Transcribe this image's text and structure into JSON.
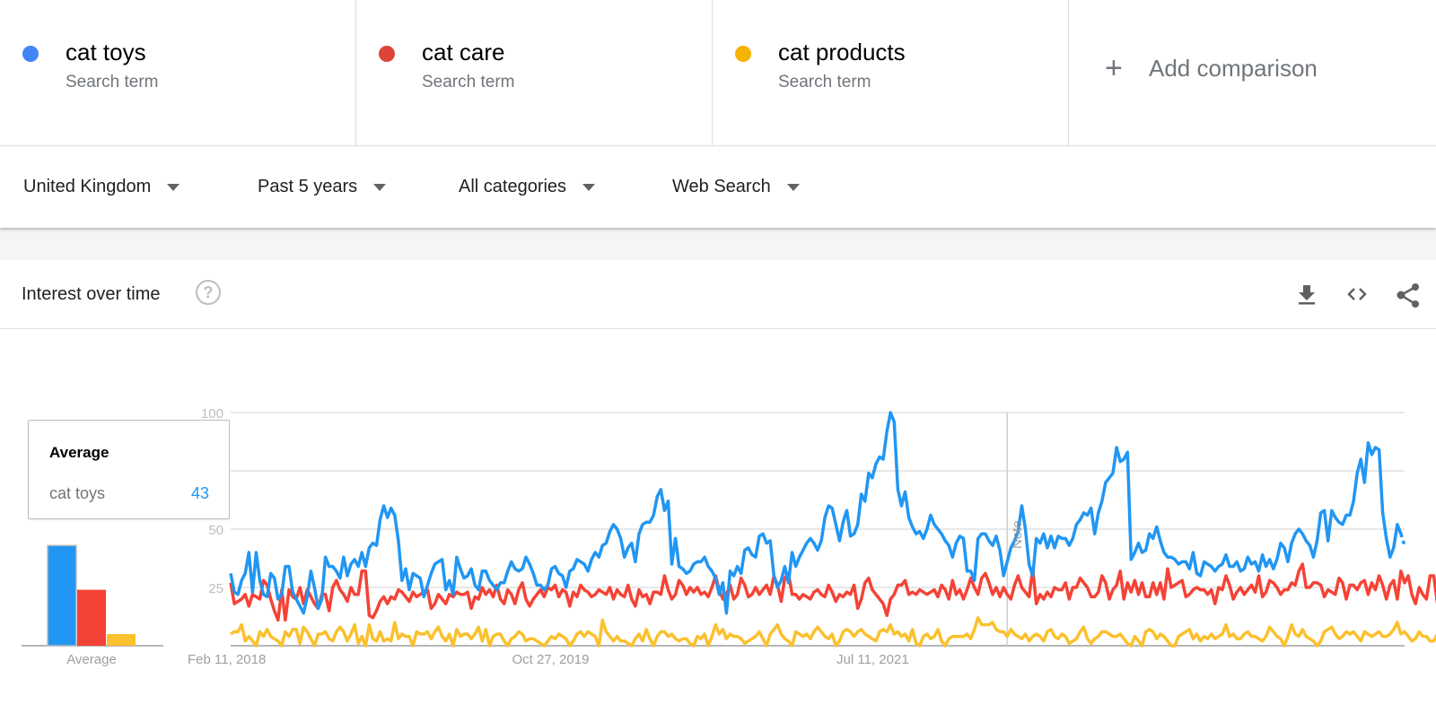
{
  "terms": [
    {
      "name": "cat toys",
      "subtitle": "Search term",
      "color": "#4285f4"
    },
    {
      "name": "cat care",
      "subtitle": "Search term",
      "color": "#db4437"
    },
    {
      "name": "cat products",
      "subtitle": "Search term",
      "color": "#f4b400"
    }
  ],
  "add_comparison": {
    "icon": "plus-icon",
    "label": "Add comparison"
  },
  "filters": [
    {
      "label": "United Kingdom"
    },
    {
      "label": "Past 5 years"
    },
    {
      "label": "All categories"
    },
    {
      "label": "Web Search"
    }
  ],
  "card": {
    "title": "Interest over time",
    "help_icon": "question-circle-icon",
    "actions": [
      "download-icon",
      "embed-code-icon",
      "share-icon"
    ]
  },
  "tooltip": {
    "title": "Average",
    "term": "cat toys",
    "value": "43"
  },
  "chart_data": [
    {
      "type": "bar",
      "title": "Average",
      "xlabel": "Average",
      "categories": [
        "cat toys",
        "cat care",
        "cat products"
      ],
      "values": [
        43,
        24,
        5
      ],
      "colors": [
        "#2196f3",
        "#f44336",
        "#fbc02d"
      ],
      "ylim": [
        0,
        100
      ]
    },
    {
      "type": "line",
      "title": "Interest over time",
      "ylabel": "",
      "xlabel": "",
      "ylim": [
        0,
        100
      ],
      "yticks": [
        25,
        50,
        75,
        100
      ],
      "xtick_labels": [
        {
          "label": "Feb 11, 2018",
          "index": 0
        },
        {
          "label": "Oct 27, 2019",
          "index": 89
        },
        {
          "label": "Jul 11, 2021",
          "index": 178
        }
      ],
      "annotation": {
        "label": "Note",
        "index": 213
      },
      "grid": true,
      "legend": "none",
      "x_start": "Feb 11, 2018",
      "x_step": "week",
      "partial_last_point": true,
      "series": [
        {
          "name": "cat toys",
          "color": "#2196f3",
          "values": [
            31,
            23,
            22,
            28,
            31,
            40,
            23,
            40,
            28,
            22,
            21,
            31,
            29,
            20,
            22,
            34,
            34,
            23,
            20,
            17,
            14,
            21,
            32,
            25,
            16,
            20,
            38,
            34,
            34,
            32,
            29,
            38,
            30,
            35,
            37,
            34,
            40,
            34,
            42,
            44,
            43,
            54,
            60,
            55,
            59,
            56,
            45,
            28,
            33,
            24,
            31,
            30,
            29,
            21,
            26,
            31,
            35,
            36,
            37,
            24,
            28,
            22,
            38,
            33,
            29,
            30,
            33,
            26,
            24,
            32,
            32,
            28,
            26,
            24,
            27,
            27,
            32,
            36,
            33,
            32,
            33,
            38,
            35,
            31,
            26,
            26,
            24,
            26,
            33,
            34,
            31,
            30,
            25,
            32,
            33,
            37,
            36,
            35,
            32,
            37,
            40,
            38,
            43,
            44,
            49,
            52,
            50,
            46,
            38,
            42,
            44,
            36,
            48,
            52,
            53,
            53,
            56,
            64,
            67,
            58,
            62,
            35,
            46,
            34,
            33,
            31,
            32,
            35,
            36,
            36,
            38,
            34,
            32,
            29,
            22,
            27,
            14,
            32,
            30,
            34,
            31,
            41,
            42,
            39,
            38,
            47,
            48,
            44,
            45,
            30,
            25,
            28,
            34,
            27,
            40,
            34,
            38,
            41,
            44,
            46,
            44,
            41,
            45,
            55,
            60,
            59,
            52,
            45,
            53,
            58,
            47,
            48,
            52,
            65,
            62,
            74,
            72,
            78,
            81,
            80,
            92,
            100,
            96,
            67,
            60,
            66,
            55,
            51,
            48,
            49,
            46,
            50,
            56,
            52,
            50,
            48,
            45,
            43,
            38,
            44,
            47,
            46,
            32,
            32,
            28,
            46,
            48,
            48,
            45,
            43,
            47,
            41,
            30,
            36,
            42,
            45,
            49,
            60,
            50,
            35,
            30,
            46,
            44,
            48,
            42,
            47,
            42,
            47,
            46,
            46,
            43,
            46,
            52,
            54,
            57,
            56,
            59,
            48,
            57,
            62,
            70,
            72,
            74,
            85,
            79,
            80,
            83,
            37,
            40,
            44,
            40,
            41,
            48,
            46,
            51,
            45,
            40,
            38,
            38,
            37,
            35,
            36,
            36,
            33,
            40,
            31,
            30,
            36,
            35,
            34,
            32,
            34,
            35,
            39,
            34,
            34,
            36,
            32,
            33,
            38,
            35,
            36,
            32,
            39,
            34,
            37,
            33,
            37,
            44,
            42,
            36,
            44,
            48,
            50,
            48,
            45,
            43,
            38,
            45,
            57,
            58,
            45,
            58,
            55,
            53,
            52,
            56,
            56,
            62,
            74,
            80,
            70,
            87,
            82,
            85,
            84,
            57,
            46,
            38,
            42,
            52,
            48,
            43
          ]
        },
        {
          "name": "cat care",
          "color": "#f44336",
          "values": [
            27,
            18,
            19,
            20,
            22,
            17,
            22,
            21,
            20,
            28,
            26,
            20,
            15,
            11,
            24,
            11,
            24,
            21,
            20,
            25,
            18,
            24,
            21,
            18,
            16,
            22,
            22,
            15,
            25,
            28,
            24,
            22,
            19,
            25,
            22,
            22,
            32,
            32,
            13,
            12,
            15,
            19,
            21,
            18,
            21,
            20,
            24,
            23,
            21,
            19,
            23,
            21,
            22,
            23,
            24,
            16,
            18,
            22,
            20,
            18,
            22,
            21,
            23,
            22,
            22,
            23,
            16,
            21,
            20,
            25,
            22,
            24,
            21,
            26,
            20,
            18,
            24,
            22,
            18,
            24,
            27,
            20,
            17,
            20,
            22,
            24,
            21,
            25,
            24,
            26,
            21,
            24,
            23,
            17,
            23,
            21,
            26,
            24,
            23,
            21,
            22,
            24,
            23,
            22,
            25,
            20,
            24,
            22,
            21,
            26,
            20,
            17,
            24,
            21,
            22,
            18,
            23,
            23,
            22,
            30,
            24,
            20,
            22,
            28,
            26,
            22,
            25,
            23,
            25,
            22,
            23,
            21,
            25,
            30,
            24,
            20,
            22,
            26,
            20,
            22,
            29,
            26,
            21,
            22,
            25,
            22,
            24,
            26,
            22,
            30,
            26,
            19,
            29,
            31,
            22,
            22,
            20,
            22,
            21,
            20,
            23,
            24,
            22,
            21,
            26,
            23,
            19,
            22,
            21,
            23,
            22,
            26,
            16,
            20,
            27,
            29,
            24,
            22,
            20,
            18,
            13,
            20,
            22,
            26,
            26,
            28,
            22,
            23,
            22,
            24,
            23,
            22,
            23,
            24,
            21,
            26,
            24,
            20,
            28,
            22,
            24,
            20,
            24,
            29,
            25,
            22,
            29,
            31,
            27,
            22,
            25,
            21,
            25,
            22,
            20,
            26,
            30,
            25,
            23,
            21,
            33,
            18,
            22,
            20,
            23,
            21,
            25,
            24,
            24,
            27,
            20,
            25,
            25,
            29,
            27,
            25,
            21,
            21,
            23,
            30,
            27,
            20,
            24,
            26,
            32,
            20,
            27,
            23,
            28,
            22,
            27,
            21,
            21,
            27,
            22,
            27,
            20,
            33,
            25,
            26,
            27,
            28,
            21,
            22,
            24,
            25,
            24,
            24,
            22,
            24,
            18,
            25,
            24,
            30,
            26,
            20,
            23,
            25,
            22,
            24,
            26,
            23,
            30,
            21,
            23,
            28,
            27,
            25,
            22,
            24,
            24,
            27,
            26,
            32,
            35,
            25,
            25,
            27,
            27,
            26,
            21,
            24,
            23,
            22,
            29,
            27,
            20,
            26,
            26,
            24,
            27,
            28,
            22,
            27,
            24,
            30,
            26,
            20,
            26,
            28,
            20,
            32,
            27,
            30,
            22,
            18,
            25,
            22,
            20,
            30,
            30,
            18,
            30,
            30,
            22,
            30,
            18
          ]
        },
        {
          "name": "cat products",
          "color": "#fbc02d",
          "values": [
            5,
            6,
            6,
            9,
            2,
            4,
            2,
            0,
            6,
            4,
            7,
            4,
            3,
            2,
            0,
            6,
            4,
            7,
            7,
            1,
            8,
            6,
            3,
            0,
            5,
            5,
            6,
            3,
            2,
            6,
            8,
            6,
            2,
            5,
            9,
            1,
            4,
            0,
            9,
            3,
            2,
            6,
            2,
            3,
            2,
            10,
            3,
            5,
            4,
            4,
            0,
            6,
            5,
            5,
            6,
            3,
            6,
            8,
            4,
            2,
            5,
            0,
            7,
            4,
            5,
            5,
            3,
            5,
            8,
            2,
            7,
            0,
            4,
            5,
            5,
            2,
            0,
            3,
            4,
            6,
            5,
            2,
            3,
            3,
            2,
            1,
            0,
            2,
            4,
            3,
            5,
            4,
            3,
            0,
            2,
            5,
            6,
            4,
            6,
            5,
            4,
            0,
            11,
            6,
            4,
            2,
            4,
            2,
            2,
            1,
            0,
            3,
            5,
            2,
            7,
            3,
            0,
            4,
            6,
            6,
            4,
            5,
            3,
            2,
            3,
            3,
            1,
            0,
            4,
            3,
            5,
            0,
            4,
            9,
            5,
            7,
            3,
            5,
            4,
            4,
            3,
            1,
            2,
            3,
            4,
            6,
            3,
            0,
            5,
            7,
            9,
            5,
            3,
            2,
            0,
            6,
            5,
            4,
            5,
            3,
            6,
            8,
            6,
            4,
            3,
            5,
            0,
            2,
            6,
            7,
            6,
            4,
            6,
            7,
            5,
            4,
            3,
            2,
            6,
            7,
            6,
            9,
            5,
            6,
            4,
            5,
            2,
            7,
            1,
            0,
            4,
            5,
            3,
            4,
            7,
            2,
            0,
            3,
            4,
            4,
            4,
            4,
            5,
            3,
            7,
            12,
            9,
            9,
            9,
            10,
            7,
            6,
            6,
            4,
            7,
            5,
            4,
            3,
            5,
            2,
            4,
            5,
            4,
            2,
            6,
            7,
            4,
            3,
            5,
            4,
            1,
            2,
            3,
            6,
            8,
            3,
            1,
            3,
            4,
            6,
            6,
            5,
            4,
            4,
            5,
            3,
            1,
            0,
            4,
            2,
            0,
            6,
            7,
            6,
            3,
            5,
            4,
            2,
            0,
            0,
            4,
            5,
            6,
            7,
            3,
            5,
            2,
            4,
            3,
            5,
            3,
            4,
            5,
            9,
            4,
            5,
            3,
            3,
            5,
            6,
            4,
            4,
            3,
            2,
            4,
            8,
            6,
            4,
            3,
            0,
            4,
            9,
            5,
            4,
            7,
            4,
            3,
            2,
            0,
            2,
            6,
            7,
            8,
            5,
            3,
            4,
            6,
            5,
            6,
            4,
            2,
            6,
            5,
            4,
            5,
            6,
            4,
            4,
            5,
            7,
            10,
            5,
            6,
            4,
            2,
            3,
            6,
            4,
            4,
            2,
            2,
            5,
            6,
            3,
            4,
            3,
            2,
            4,
            3,
            3,
            2,
            0,
            1,
            2,
            3,
            2,
            4,
            5,
            3
          ]
        }
      ]
    }
  ]
}
